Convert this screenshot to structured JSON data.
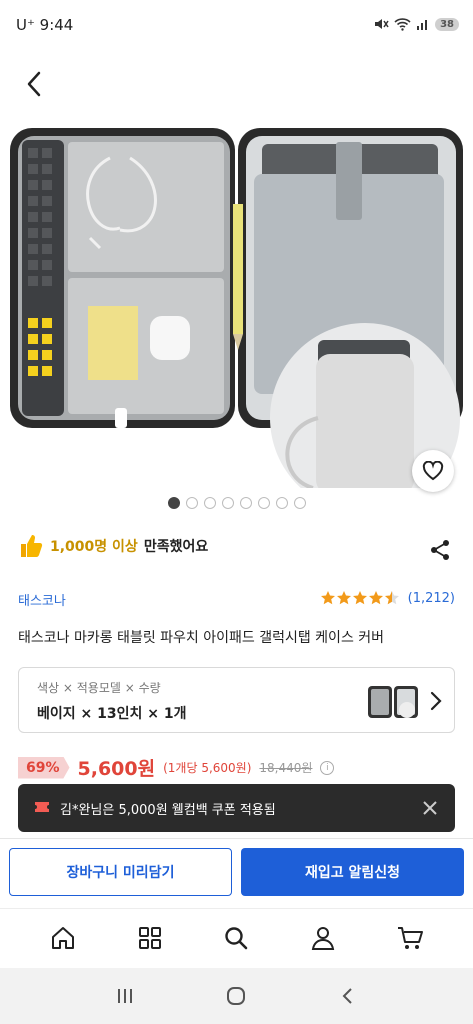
{
  "status_bar": {
    "carrier_time": "U⁺ 9:44",
    "battery": "38"
  },
  "gallery": {
    "page_count": 8,
    "active_index": 0
  },
  "satisfaction": {
    "count": "1,000명 이상",
    "text": "만족했어요"
  },
  "brand": "태스코나",
  "rating": {
    "stars": 4.5,
    "count": "(1,212)"
  },
  "product_title": "태스코나 마카롱 태블릿 파우치 아이패드 갤럭시탭 케이스 커버",
  "option": {
    "labels": "색상 × 적용모델 × 수량",
    "values": "베이지 × 13인치 × 1개"
  },
  "price": {
    "discount": "69%",
    "sale": "5,600원",
    "unit": "(1개당 5,600원)",
    "original": "18,440원"
  },
  "coupon_toast": {
    "text": "김*완님은 5,000원 웰컴백 쿠폰 적용됨"
  },
  "buttons": {
    "cart": "장바구니 미리담기",
    "notify": "재입고 알림신청"
  },
  "bottom_nav": [
    {
      "icon": "home-icon"
    },
    {
      "icon": "category-grid-icon"
    },
    {
      "icon": "search-icon"
    },
    {
      "icon": "profile-icon"
    },
    {
      "icon": "cart-icon"
    }
  ],
  "colors": {
    "accent": "#1e5fd8",
    "price": "#e0453a",
    "toast_bg": "#2b2b2b",
    "star": "#f29a1a"
  }
}
